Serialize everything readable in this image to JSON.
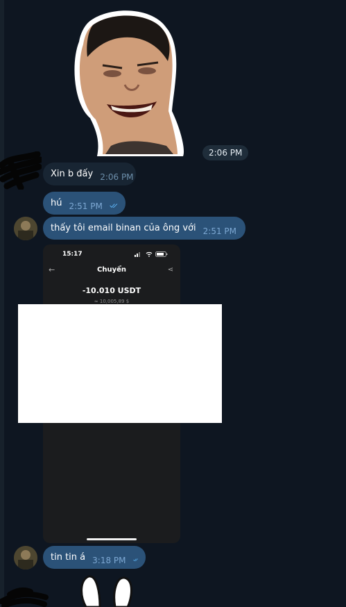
{
  "messages": [
    {
      "text": "Xin b đấy",
      "time": "2:06 PM"
    },
    {
      "text": "hú",
      "time": "2:51 PM"
    },
    {
      "text": "thấy tôi email binan của ông với",
      "time": "2:51 PM"
    },
    {
      "text": "tin tin á",
      "time": "3:18 PM"
    }
  ],
  "sticker": {
    "time": "2:06 PM"
  },
  "screenshot": {
    "clock": "15:17",
    "title": "Chuyển",
    "amount": "-10.010 USDT",
    "fiat": "≈ 10,005,89 $"
  },
  "icons": {
    "read_receipt": "double-check-icon",
    "back": "arrow-left-icon",
    "share": "share-icon"
  },
  "colors": {
    "background": "#0e1621",
    "incoming_bubble": "#182533",
    "outgoing_bubble": "#2b5278",
    "tick": "#5eb5f7"
  }
}
